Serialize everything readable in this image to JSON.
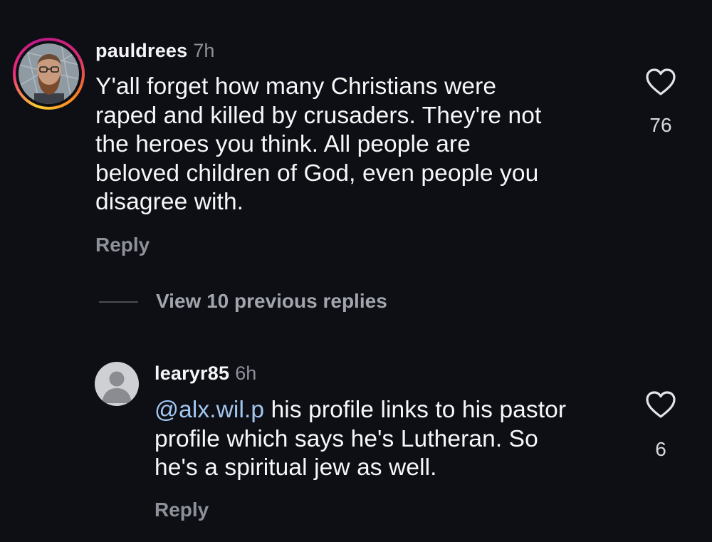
{
  "comments": [
    {
      "username": "pauldrees",
      "timestamp": "7h",
      "lines": [
        "Y'all forget how many Christians were",
        "raped and killed by crusaders. They're not",
        "the heroes you think. All people are",
        "beloved children of God, even people you",
        "disagree with."
      ],
      "likes": "76",
      "reply_label": "Reply",
      "avatar_icon": "profile-photo-with-story-ring"
    }
  ],
  "view_replies_label": "View 10 previous replies",
  "replies": [
    {
      "username": "learyr85",
      "timestamp": "6h",
      "mention": "@alx.wil.p",
      "lines": [
        " his profile links to his pastor",
        "profile which says he's Lutheran. So",
        "he's a spiritual jew as well."
      ],
      "likes": "6",
      "reply_label": "Reply",
      "avatar_icon": "default-person-icon"
    }
  ],
  "colors": {
    "background": "#0d0f14",
    "text": "#f5f5f7",
    "muted": "#8e9199",
    "mention": "#a3c7f1"
  }
}
